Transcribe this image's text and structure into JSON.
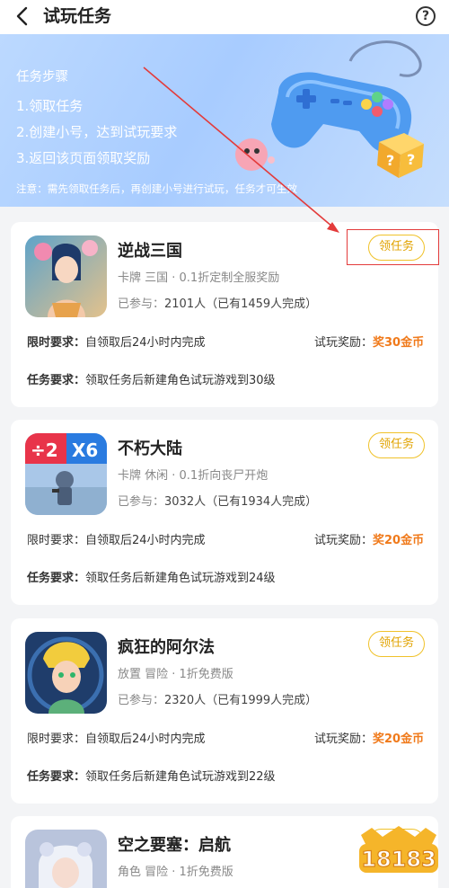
{
  "header": {
    "title": "试玩任务",
    "help": "?"
  },
  "banner": {
    "steps_title": "任务步骤",
    "steps": [
      "1.领取任务",
      "2.创建小号，达到试玩要求",
      "3.返回该页面领取奖励"
    ],
    "note": "注意：需先领取任务后，再创建小号进行试玩，任务才可生效"
  },
  "labels": {
    "time_req": "限时要求：",
    "reward": "试玩奖励：",
    "task_req": "任务要求：",
    "joined_prefix": "已参与："
  },
  "games": [
    {
      "name": "逆战三国",
      "tags": "卡牌 三国 · 0.1折定制全服奖励",
      "joined": "2101人（已有1459人完成）",
      "button": "领任务",
      "time_limit": "自领取后24小时内完成",
      "reward": "奖30金币",
      "requirement": "领取任务后新建角色试玩游戏到30级"
    },
    {
      "name": "不朽大陆",
      "tags": "卡牌 休闲 · 0.1折向丧尸开炮",
      "joined": "3032人（已有1934人完成）",
      "button": "领任务",
      "time_limit": "自领取后24小时内完成",
      "reward": "奖20金币",
      "requirement": "领取任务后新建角色试玩游戏到24级",
      "icon_text": [
        "÷2",
        "X6"
      ]
    },
    {
      "name": "疯狂的阿尔法",
      "tags": "放置 冒险 · 1折免费版",
      "joined": "2320人（已有1999人完成）",
      "button": "领任务",
      "time_limit": "自领取后24小时内完成",
      "reward": "奖20金币",
      "requirement": "领取任务后新建角色试玩游戏到22级"
    },
    {
      "name": "空之要塞：启航",
      "tags": "角色 冒险 · 1折免费版",
      "button": "领任"
    }
  ],
  "watermark": "18183",
  "colors": {
    "accent": "#f0c22a",
    "reward": "#f07a1b",
    "highlight": "#e33b3b",
    "banner": "#b3d2ff"
  },
  "icons": [
    "back-arrow-icon",
    "help-icon",
    "controller-icon",
    "red-arrow-icon"
  ]
}
